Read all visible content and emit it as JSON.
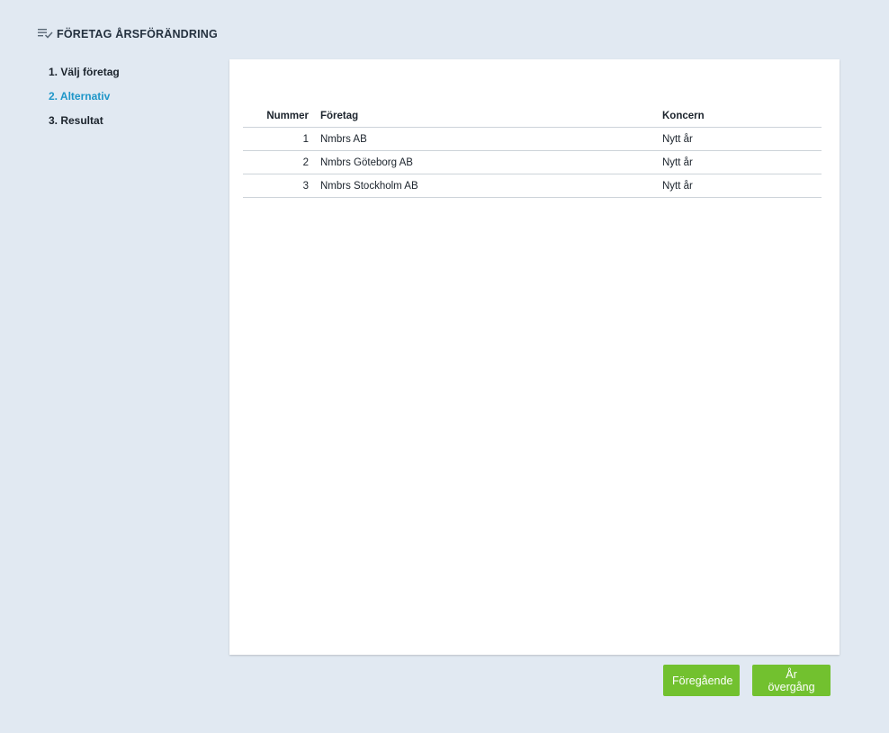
{
  "header": {
    "icon": "checklist-icon",
    "title": "FÖRETAG ÅRSFÖRÄNDRING"
  },
  "steps": [
    {
      "label": "1. Välj företag",
      "active": false
    },
    {
      "label": "2. Alternativ",
      "active": true
    },
    {
      "label": "3. Resultat",
      "active": false
    }
  ],
  "table": {
    "headers": {
      "number": "Nummer",
      "company": "Företag",
      "group": "Koncern"
    },
    "rows": [
      {
        "number": "1",
        "company": "Nmbrs AB",
        "group": "Nytt år"
      },
      {
        "number": "2",
        "company": "Nmbrs Göteborg AB",
        "group": "Nytt år"
      },
      {
        "number": "3",
        "company": "Nmbrs Stockholm AB",
        "group": "Nytt år"
      }
    ]
  },
  "buttons": {
    "previous_label": "Föregående",
    "next_label": "År övergång"
  },
  "colors": {
    "background": "#e1e9f2",
    "active_step": "#1e96c8",
    "button": "#72c12f"
  }
}
